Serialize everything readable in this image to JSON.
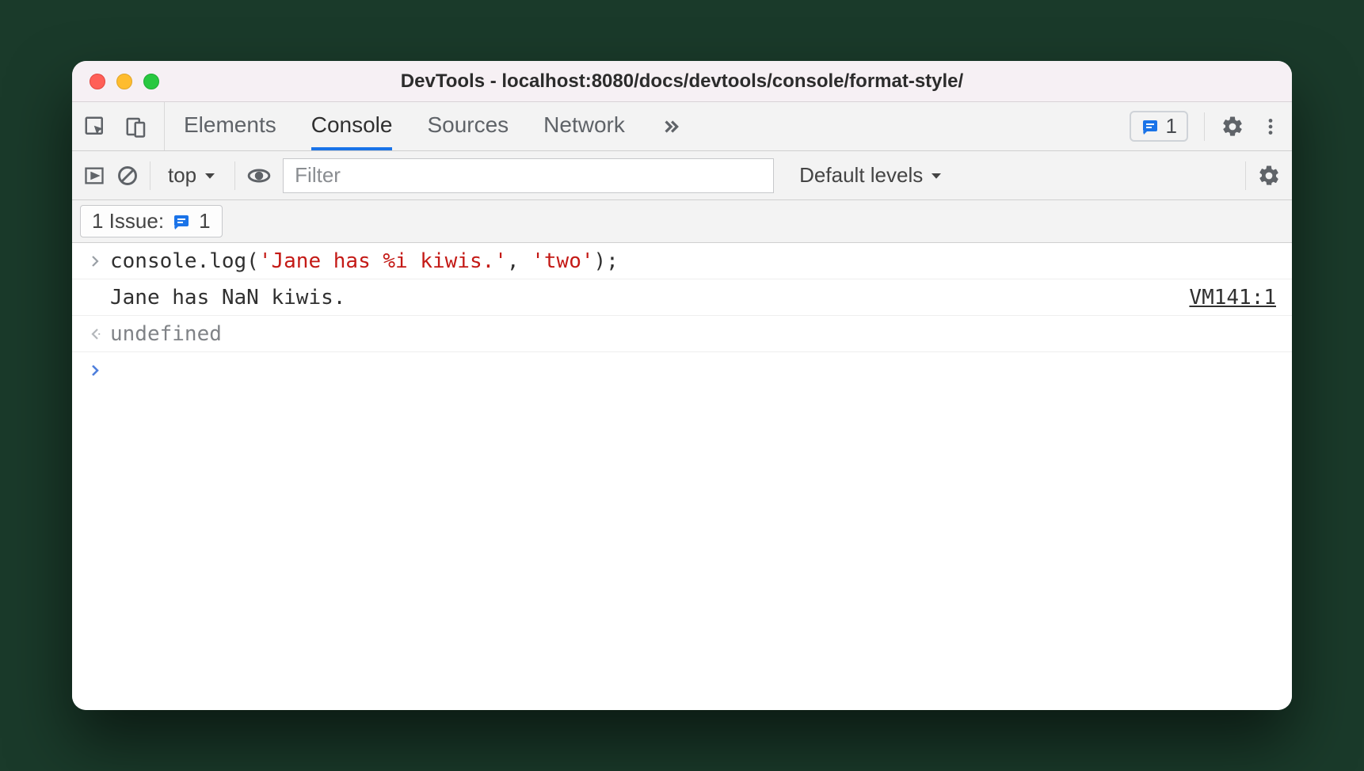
{
  "window": {
    "title": "DevTools - localhost:8080/docs/devtools/console/format-style/"
  },
  "tabbar": {
    "tabs": {
      "elements": "Elements",
      "console": "Console",
      "sources": "Sources",
      "network": "Network"
    },
    "issues_count": "1"
  },
  "toolbar": {
    "context": "top",
    "filter_placeholder": "Filter",
    "levels": "Default levels"
  },
  "issues_bar": {
    "label": "1 Issue:",
    "count": "1"
  },
  "console": {
    "input_fn": "console.log(",
    "input_str1": "'Jane has %i kiwis.'",
    "input_comma": ", ",
    "input_str2": "'two'",
    "input_end": ");",
    "output": "Jane has NaN kiwis.",
    "source": "VM141:1",
    "return": "undefined"
  }
}
